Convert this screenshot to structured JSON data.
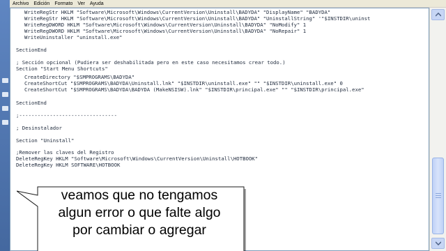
{
  "menubar": {
    "items": [
      "Archivo",
      "Edición",
      "Formato",
      "Ver",
      "Ayuda"
    ]
  },
  "code": {
    "lines": [
      "WriteRegStr HKLM \"Software\\Microsoft\\Windows\\CurrentVersion\\Uninstall\\BADYDA\" \"DisplayName\" \"BADYDA\"",
      "WriteRegStr HKLM \"Software\\Microsoft\\Windows\\CurrentVersion\\Uninstall\\BADYDA\" \"UninstallString\" '\"$INSTDIR\\uninst",
      "WriteRegDWORD HKLM \"Software\\Microsoft\\Windows\\CurrentVersion\\Uninstall\\BADYDA\" \"NoModify\" 1",
      "WriteRegDWORD HKLM \"Software\\Microsoft\\Windows\\CurrentVersion\\Uninstall\\BADYDA\" \"NoRepair\" 1",
      "WriteUninstaller \"uninstall.exe\"",
      "SectionEnd",
      "; Sección opcional (Pudiera ser deshabilitada pero en este caso necesitamos crear todo.)",
      "Section \"Start Menu Shortcuts\"",
      "CreateDirectory \"$SMPROGRAMS\\BADYDA\"",
      "CreateShortCut \"$SMPROGRAMS\\BADYDA\\Uninstall.lnk\" \"$INSTDIR\\uninstall.exe\" \"\" \"$INSTDIR\\uninstall.exe\" 0",
      "CreateShortCut \"$SMPROGRAMS\\BADYDA\\BADYDA (MakeNSISW).lnk\" \"$INSTDIR\\principal.exe\" \"\" \"$INSTDIR\\principal.exe\"",
      "SectionEnd",
      ";--------------------------------",
      "; Desinstalador",
      "Section \"Uninstall\"",
      ";Remover las claves del Registro",
      "DeleteRegKey HKLM \"Software\\Microsoft\\Windows\\CurrentVersion\\Uninstall\\HOTBOOK\"",
      "DeleteRegKey HKLM SOFTWARE\\HOTBOOK"
    ]
  },
  "callout": {
    "line1": "veamos que no tengamos",
    "line2": "algun error o que falte algo",
    "line3": "por cambiar o agregar"
  },
  "colors": {
    "text": "#1f2a3c",
    "desktop": "#3a5a8c",
    "callout_fill": "#ffffff",
    "scroll_thumb": "#c7d6f5"
  },
  "icons": {
    "scroll_up": "arrow-up-icon",
    "scroll_down": "arrow-down-icon"
  }
}
